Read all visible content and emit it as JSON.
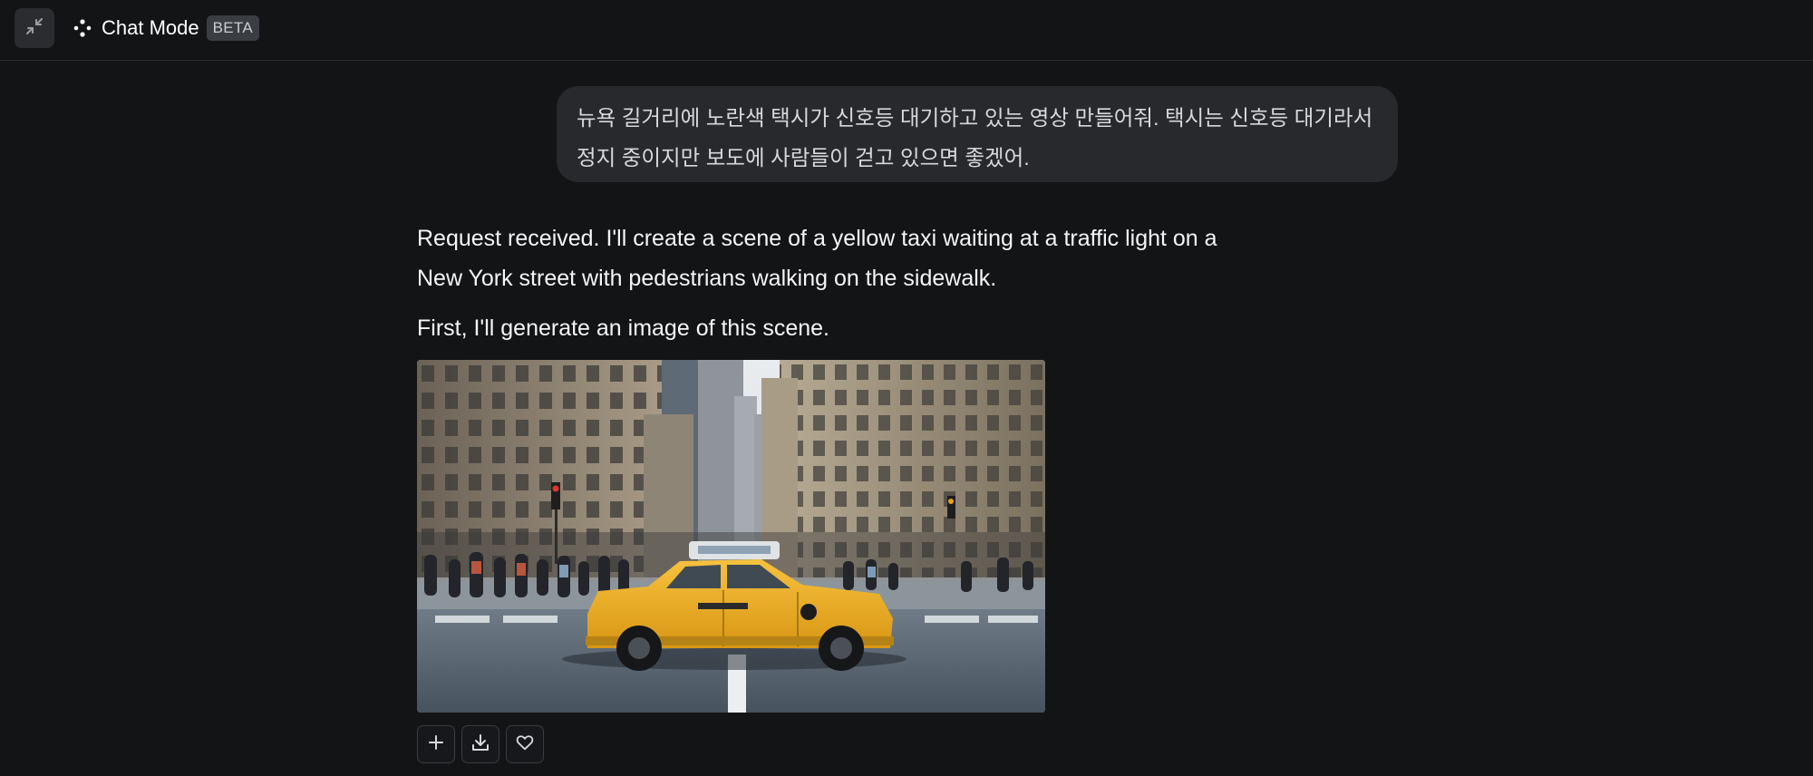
{
  "header": {
    "mode_label": "Chat Mode",
    "badge": "BETA",
    "collapse_icon": "collapse-arrows-icon",
    "mode_icon": "sparkle-dots-icon"
  },
  "conversation": {
    "user_message": {
      "line1": "뉴욕 길거리에 노란색 택시가 신호등 대기하고 있는 영상 만들어줘. 택시는 신호등 대기라서",
      "line2": "정지 중이지만 보도에 사람들이 걷고 있으면 좋겠어."
    },
    "assistant_messages": [
      "Request received. I'll create a scene of a yellow taxi waiting at a traffic light on a New York street with pedestrians walking on the sidewalk.",
      "First, I'll generate an image of this scene."
    ],
    "image_actions": [
      {
        "icon": "plus-icon"
      },
      {
        "icon": "download-icon"
      },
      {
        "icon": "heart-icon"
      }
    ]
  },
  "colors": {
    "background": "#131416",
    "user_bubble": "#27292d",
    "taxi_yellow": "#f2b22a"
  }
}
